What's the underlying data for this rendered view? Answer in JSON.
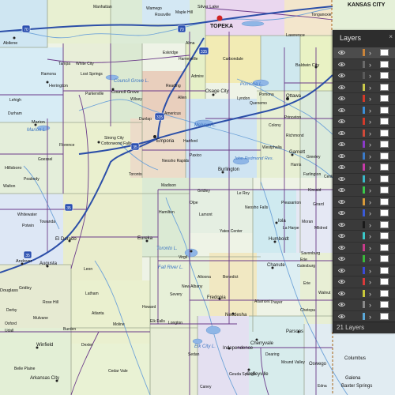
{
  "map": {
    "cities": [
      {
        "name": "TOPEKA",
        "capital": true
      },
      {
        "name": "Abilene"
      },
      {
        "name": "Herington"
      },
      {
        "name": "Council Grove"
      },
      {
        "name": "Emporia"
      },
      {
        "name": "Osage City"
      },
      {
        "name": "Ottawa"
      },
      {
        "name": "Baldwin City"
      },
      {
        "name": "Burlington"
      },
      {
        "name": "Garnett"
      },
      {
        "name": "Iola"
      },
      {
        "name": "Humboldt"
      },
      {
        "name": "Chanute"
      },
      {
        "name": "Eureka"
      },
      {
        "name": "El Dorado"
      },
      {
        "name": "Augusta"
      },
      {
        "name": "Andover"
      },
      {
        "name": "Winfield"
      },
      {
        "name": "Arkansas City"
      },
      {
        "name": "Fredonia"
      },
      {
        "name": "Neodesha"
      },
      {
        "name": "Independence"
      },
      {
        "name": "Cherryvale"
      },
      {
        "name": "Coffeyville"
      },
      {
        "name": "Parsons"
      },
      {
        "name": "Columbus"
      },
      {
        "name": "Galena"
      },
      {
        "name": "Baxter Springs"
      },
      {
        "name": "Oswego"
      },
      {
        "name": "Hillsboro"
      },
      {
        "name": "Marion"
      },
      {
        "name": "Cottonwood Falls"
      },
      {
        "name": "Strong City"
      },
      {
        "name": "Madison"
      },
      {
        "name": "Hamilton"
      },
      {
        "name": "Yates Center"
      },
      {
        "name": "Erie"
      },
      {
        "name": "Wamego"
      },
      {
        "name": "Manhattan"
      },
      {
        "name": "Lawrence"
      },
      {
        "name": "Carbondale"
      },
      {
        "name": "Lyndon"
      },
      {
        "name": "Quenemo"
      },
      {
        "name": "Pomona"
      },
      {
        "name": "Princeton"
      },
      {
        "name": "Richmond"
      },
      {
        "name": "Le Roy"
      },
      {
        "name": "Gridley"
      },
      {
        "name": "Neosho Falls"
      },
      {
        "name": "La Harpe"
      },
      {
        "name": "Moran"
      },
      {
        "name": "Savonburg"
      },
      {
        "name": "Benedict"
      },
      {
        "name": "Altoona"
      },
      {
        "name": "New Albany"
      },
      {
        "name": "Severy"
      },
      {
        "name": "Howard"
      },
      {
        "name": "Moline"
      },
      {
        "name": "Elk Falls"
      },
      {
        "name": "Longton"
      },
      {
        "name": "Sedan"
      },
      {
        "name": "Caney"
      },
      {
        "name": "Cedar Vale"
      },
      {
        "name": "Dexter"
      },
      {
        "name": "Burden"
      },
      {
        "name": "Atlanta"
      },
      {
        "name": "Latham"
      },
      {
        "name": "Leon"
      },
      {
        "name": "Towanda"
      },
      {
        "name": "Whitewater"
      },
      {
        "name": "Potwin"
      },
      {
        "name": "Peabody"
      },
      {
        "name": "Florence"
      },
      {
        "name": "Durham"
      },
      {
        "name": "Lehigh"
      },
      {
        "name": "Goessel"
      },
      {
        "name": "Walton"
      },
      {
        "name": "Lost Springs"
      },
      {
        "name": "Ramona"
      },
      {
        "name": "Tampa"
      },
      {
        "name": "White City"
      },
      {
        "name": "Parkerville"
      },
      {
        "name": "Wilsey"
      },
      {
        "name": "Dunlap"
      },
      {
        "name": "Americus"
      },
      {
        "name": "Reading"
      },
      {
        "name": "Allen"
      },
      {
        "name": "Admire"
      },
      {
        "name": "Harveyville"
      },
      {
        "name": "Eskridge"
      },
      {
        "name": "Alma"
      },
      {
        "name": "Paxico"
      },
      {
        "name": "Hartford"
      },
      {
        "name": "Neosho Rapids"
      },
      {
        "name": "Olpe"
      },
      {
        "name": "Virgil"
      },
      {
        "name": "Toronto"
      },
      {
        "name": "Lamont"
      },
      {
        "name": "Gridley"
      },
      {
        "name": "Rose Hill"
      },
      {
        "name": "Douglass"
      },
      {
        "name": "Derby"
      },
      {
        "name": "Mulvane"
      },
      {
        "name": "Udall"
      },
      {
        "name": "Oxford"
      },
      {
        "name": "Belle Plaine"
      },
      {
        "name": "Geuda Springs"
      },
      {
        "name": "Dearing"
      },
      {
        "name": "Mound Valley"
      },
      {
        "name": "Edna"
      },
      {
        "name": "Chetopa"
      },
      {
        "name": "Altamont"
      },
      {
        "name": "Thayer"
      },
      {
        "name": "Galesburg"
      },
      {
        "name": "Erie"
      },
      {
        "name": "Walnut"
      },
      {
        "name": "Girard"
      },
      {
        "name": "Farlington"
      },
      {
        "name": "Kincaid"
      },
      {
        "name": "Colony"
      },
      {
        "name": "Westphalia"
      },
      {
        "name": "Harris"
      },
      {
        "name": "Greeley"
      },
      {
        "name": "Centerville"
      },
      {
        "name": "Pleasanton"
      },
      {
        "name": "Mildred"
      },
      {
        "name": "Bronson"
      }
    ],
    "water_labels": [
      "Council Grove L.",
      "Pomona L.",
      "John Redmond Res.",
      "Marion L.",
      "Melvern L.",
      "Toronto L.",
      "Fall River L.",
      "Elk City L."
    ],
    "highway_shields": [
      "70",
      "70",
      "335",
      "335",
      "35",
      "35",
      "35"
    ],
    "top_labels": [
      "Silver Lake",
      "Maple Hill",
      "Rossville",
      "Tonganoxie",
      "KANSAS CITY"
    ]
  },
  "layers_panel": {
    "title": "Layers",
    "close_label": "×",
    "count_label": "21 Layers",
    "layers": [
      {
        "color": "#c9843a",
        "selected": true
      },
      {
        "color": "#6a6a6a",
        "selected": false
      },
      {
        "color": "#5a5a5a",
        "selected": false
      },
      {
        "color": "#c9c94a",
        "selected": false
      },
      {
        "color": "#d23a2a",
        "selected": false
      },
      {
        "color": "#3a8fd8",
        "selected": false
      },
      {
        "color": "#d23a2a",
        "selected": false
      },
      {
        "color": "#d04a3a",
        "selected": false
      },
      {
        "color": "#8a3ac8",
        "selected": false
      },
      {
        "color": "#3a7ac8",
        "selected": false
      },
      {
        "color": "#c83aa8",
        "selected": false
      },
      {
        "color": "#3ab8c8",
        "selected": false
      },
      {
        "color": "#3ac84a",
        "selected": false
      },
      {
        "color": "#d89a3a",
        "selected": false
      },
      {
        "color": "#3a5ad8",
        "selected": false
      },
      {
        "color": "#1a1a1a",
        "selected": false
      },
      {
        "color": "#3ac8c8",
        "selected": false
      },
      {
        "color": "#c83a8a",
        "selected": false
      },
      {
        "color": "#3ab83a",
        "selected": false
      },
      {
        "color": "#3a4ad8",
        "selected": false
      },
      {
        "color": "#d83a3a",
        "selected": false
      },
      {
        "color": "#c8c83a",
        "selected": false
      },
      {
        "color": "#8a8a8a",
        "selected": false
      },
      {
        "color": "#5aa8d8",
        "selected": false
      }
    ]
  }
}
